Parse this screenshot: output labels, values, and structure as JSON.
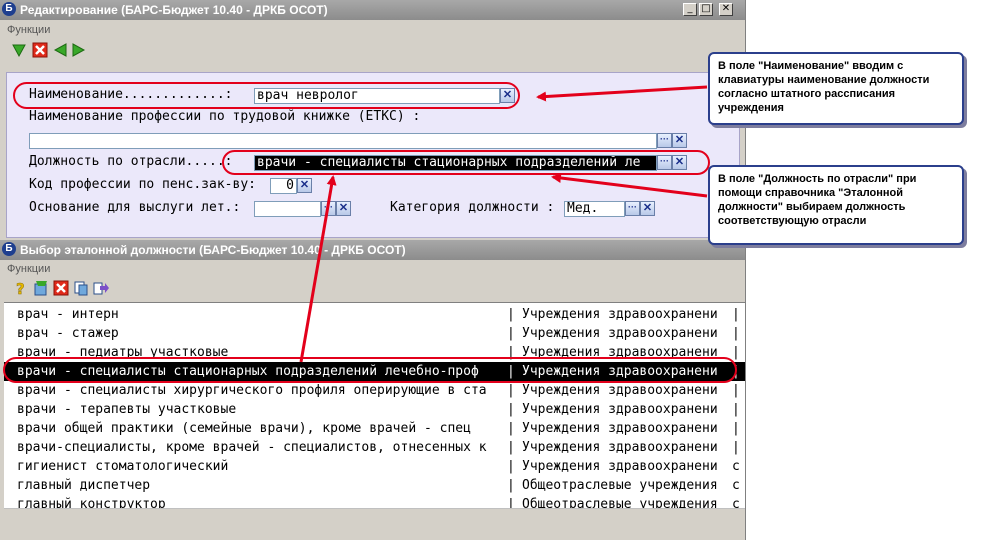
{
  "edit_window": {
    "title": "Редактирование (БАРС-Бюджет 10.40 - ДРКБ ОСОТ)",
    "menu": "Функции",
    "title_buttons": [
      "_",
      "□",
      "✕"
    ],
    "toolbar_icons": [
      "check-down-icon",
      "cancel-icon",
      "nav-left-icon",
      "nav-right-icon"
    ],
    "fields": {
      "name_label": "Наименование.............:",
      "name_value": "врач невролог",
      "profession_label": "Наименование профессии по трудовой книжке (ЕТКС) :",
      "profession_value": "",
      "position_label": "Должность по отрасли.....:",
      "position_value": "врачи - специалисты стационарных  подразделений ле",
      "pension_label": "Код профессии по пенс.зак-ву:",
      "pension_value": "0",
      "seniority_label": "Основание для выслуги лет.:",
      "seniority_value": "",
      "category_label": "Категория должности :",
      "category_value": "Мед."
    }
  },
  "select_window": {
    "title": "Выбор эталонной должности (БАРС-Бюджет 10.40 - ДРКБ ОСОТ)",
    "menu": "Функции",
    "toolbar_icons": [
      "help-icon",
      "edit-icon",
      "cancel-icon",
      "copy-icon",
      "export-icon"
    ],
    "rows": [
      {
        "name": "врач - интерн",
        "org": "Учреждения здравоохранени",
        "tail": "|"
      },
      {
        "name": "врач - стажер",
        "org": "Учреждения здравоохранени",
        "tail": "|"
      },
      {
        "name": "врачи - педиатры участковые",
        "org": "Учреждения здравоохранени",
        "tail": "|"
      },
      {
        "name": "врачи - специалисты стационарных  подразделений лечебно-проф",
        "org": "Учреждения здравоохранени",
        "tail": "|"
      },
      {
        "name": "врачи - специалисты хирургического профиля оперирующие в ста",
        "org": "Учреждения здравоохранени",
        "tail": "|"
      },
      {
        "name": "врачи - терапевты  участковые",
        "org": "Учреждения здравоохранени",
        "tail": "|"
      },
      {
        "name": "врачи общей  практики  (семейные врачи), кроме врачей - спец",
        "org": "Учреждения здравоохранени",
        "tail": "|"
      },
      {
        "name": "врачи-специалисты, кроме врачей - специалистов, отнесенных к",
        "org": "Учреждения здравоохранени",
        "tail": "|"
      },
      {
        "name": "гигиенист стоматологический",
        "org": "Учреждения здравоохранени",
        "tail": "с"
      },
      {
        "name": "главный диспетчер",
        "org": "Общеотраслевые учреждения",
        "tail": "с"
      },
      {
        "name": "главный конструктор",
        "org": "Общеотраслевые учреждения",
        "tail": "с"
      }
    ],
    "selected_index": 3
  },
  "annotations": {
    "callout1": "В поле \"Наименование\" вводим с клавиатуры наименование должности согласно штатного рассписания учреждения",
    "callout2": "В поле \"Должность по отрасли\" при помощи справочника \"Эталонной должности\" выбираем должность соответствующую отрасли"
  },
  "colors": {
    "highlight": "#e3001b",
    "callout_border": "#2b3f8c",
    "form_background": "#ebe8fa",
    "selection": "#000000"
  }
}
